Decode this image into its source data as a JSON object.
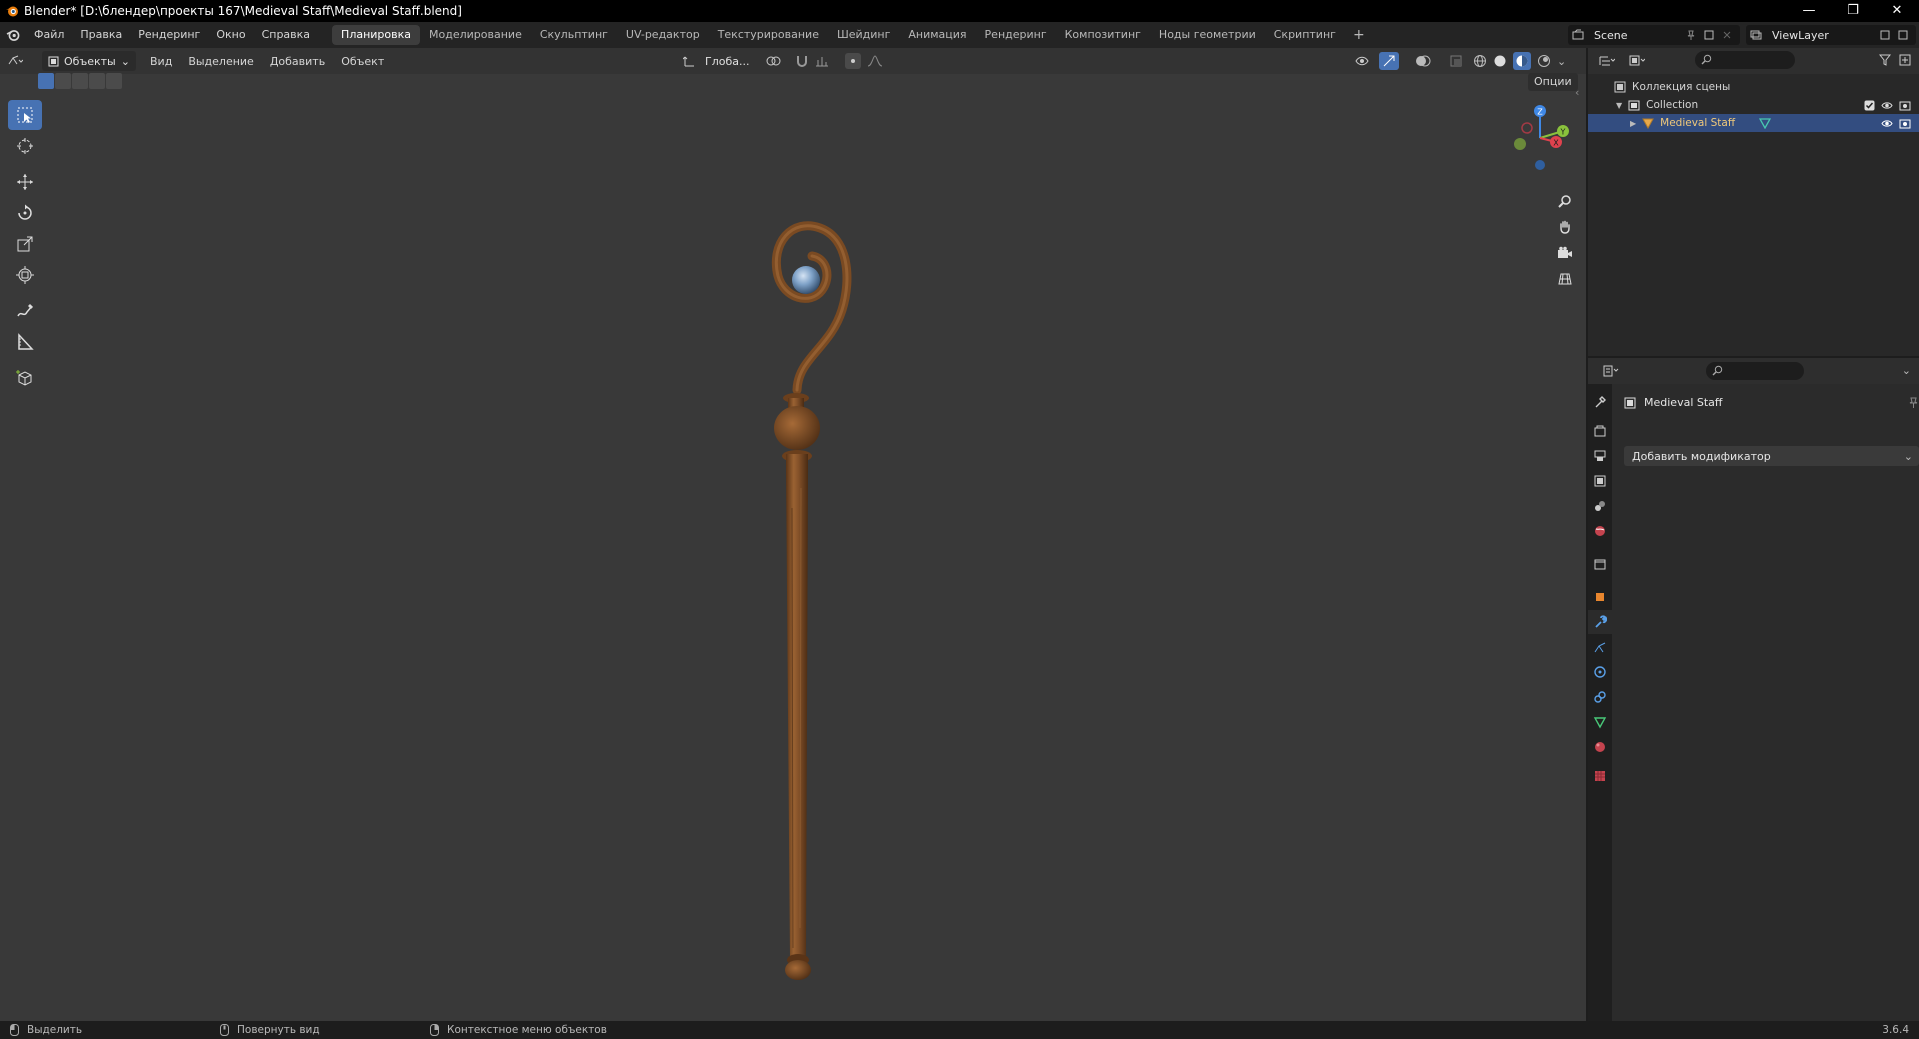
{
  "window": {
    "title": "Blender* [D:\\блендер\\проекты 167\\Medieval Staff\\Medieval Staff.blend]",
    "controls": [
      "—",
      "❐",
      "✕"
    ]
  },
  "menu": [
    "Файл",
    "Правка",
    "Рендеринг",
    "Окно",
    "Справка"
  ],
  "workspaces": {
    "tabs": [
      "Планировка",
      "Моделирование",
      "Скульптинг",
      "UV-редактор",
      "Текстурирование",
      "Шейдинг",
      "Анимация",
      "Рендеринг",
      "Композитинг",
      "Ноды геометрии",
      "Скриптинг"
    ],
    "active": "Планировка",
    "add": "+"
  },
  "scene": {
    "name": "Scene",
    "view_layer": "ViewLayer"
  },
  "viewport": {
    "mode": "Объекты",
    "menus": [
      "Вид",
      "Выделение",
      "Добавить",
      "Объект"
    ],
    "orientation": "Глоба...",
    "options": "Опции",
    "object_name": "Medieval Staff"
  },
  "outliner": {
    "root": "Коллекция сцены",
    "collection": "Collection",
    "object": "Medieval Staff"
  },
  "properties": {
    "object_name": "Medieval Staff",
    "add_modifier": "Добавить модификатор"
  },
  "statusbar": {
    "items": [
      "Выделить",
      "Повернуть вид",
      "Контекстное меню объектов"
    ],
    "version": "3.6.4"
  },
  "colors": {
    "accent": "#4772b3",
    "selected_row": "#334d80",
    "viewport_bg": "#393939",
    "axis_x": "#e0424e",
    "axis_y": "#8ac23c",
    "axis_z": "#3f88e6"
  }
}
